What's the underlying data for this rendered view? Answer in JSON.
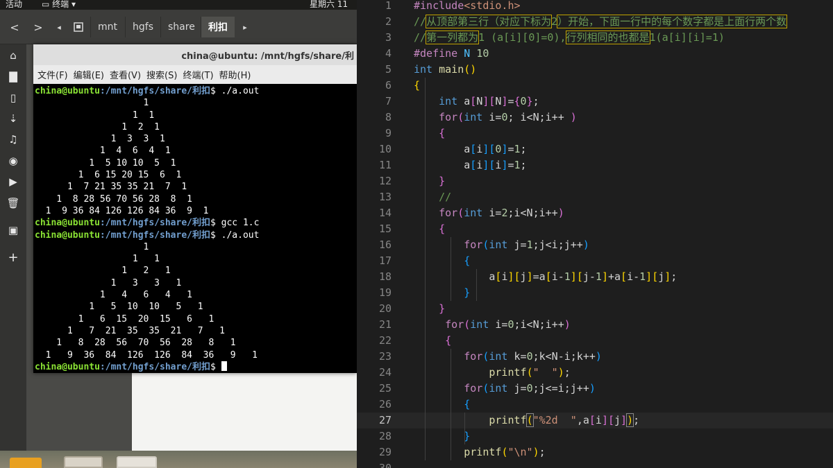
{
  "desktop": {
    "topbar": {
      "activities": "活动",
      "app_menu": "终端",
      "clock": "星期六 11"
    },
    "file_manager": {
      "back": "<",
      "forward": ">",
      "breadcrumbs": [
        "mnt",
        "hgfs",
        "share",
        "利扣"
      ]
    },
    "terminal": {
      "title": "china@ubuntu: /mnt/hgfs/share/利",
      "menu": [
        "文件(F)",
        "编辑(E)",
        "查看(V)",
        "搜索(S)",
        "终端(T)",
        "帮助(H)"
      ],
      "prompt_user": "china@ubuntu",
      "prompt_path": ":/mnt/hgfs/share/利扣",
      "lines": [
        {
          "kind": "prompt",
          "cmd": "$ ./a.out"
        },
        {
          "kind": "out",
          "text": "                    1"
        },
        {
          "kind": "out",
          "text": "                  1  1"
        },
        {
          "kind": "out",
          "text": "                1  2  1"
        },
        {
          "kind": "out",
          "text": "              1  3  3  1"
        },
        {
          "kind": "out",
          "text": "            1  4  6  4  1"
        },
        {
          "kind": "out",
          "text": "          1  5 10 10  5  1"
        },
        {
          "kind": "out",
          "text": "        1  6 15 20 15  6  1"
        },
        {
          "kind": "out",
          "text": "      1  7 21 35 35 21  7  1"
        },
        {
          "kind": "out",
          "text": "    1  8 28 56 70 56 28  8  1"
        },
        {
          "kind": "out",
          "text": "  1  9 36 84 126 126 84 36  9  1"
        },
        {
          "kind": "prompt",
          "cmd": "$ gcc 1.c"
        },
        {
          "kind": "prompt",
          "cmd": "$ ./a.out"
        },
        {
          "kind": "out",
          "text": "                    1"
        },
        {
          "kind": "out",
          "text": "                  1   1"
        },
        {
          "kind": "out",
          "text": "                1   2   1"
        },
        {
          "kind": "out",
          "text": "              1   3   3   1"
        },
        {
          "kind": "out",
          "text": "            1   4   6   4   1"
        },
        {
          "kind": "out",
          "text": "          1   5  10  10   5   1"
        },
        {
          "kind": "out",
          "text": "        1   6  15  20  15   6   1"
        },
        {
          "kind": "out",
          "text": "      1   7  21  35  35  21   7   1"
        },
        {
          "kind": "out",
          "text": "    1   8  28  56  70  56  28   8   1"
        },
        {
          "kind": "out",
          "text": "  1   9  36  84  126  126  84  36   9   1"
        },
        {
          "kind": "prompt",
          "cmd": "$ "
        }
      ]
    }
  },
  "editor": {
    "lines": [
      {
        "n": "1",
        "html": "<span class=\"pr\">#include</span><span class=\"st\">&lt;stdio.h&gt;</span>"
      },
      {
        "n": "2",
        "html": "<span class=\"cm\">//<span class=\"hl\">从顶部第三行（对应下标为</span>2<span class=\"hl\">）开始，下面一行中的每个数字都是上面行两个数</span></span>"
      },
      {
        "n": "3",
        "html": "<span class=\"cm\">//<span class=\"hl\">第一列都为</span>1 (a[i][0]=0),<span class=\"hl\">行列相同的也都是</span>1(a[i][i]=1)</span>"
      },
      {
        "n": "4",
        "html": "<span class=\"pr\">#define</span> <span class=\"ct\">N</span> <span class=\"nm\">10</span>"
      },
      {
        "n": "5",
        "html": "<span class=\"kw\">int</span> <span class=\"fn\">main</span><span class=\"b1\">()</span>"
      },
      {
        "n": "6",
        "html": "<span class=\"b1\">{</span>"
      },
      {
        "n": "7",
        "html": "    <span class=\"kw\">int</span> a<span class=\"b2\">[</span>N<span class=\"b2\">]</span><span class=\"b2\">[</span>N<span class=\"b2\">]</span>=<span class=\"b2\">{</span><span class=\"nm\">0</span><span class=\"b2\">}</span>;"
      },
      {
        "n": "8",
        "html": "    <span class=\"pr\">for</span><span class=\"b2\">(</span><span class=\"kw\">int</span> i=<span class=\"nm\">0</span>; i&lt;N;i++ <span class=\"b2\">)</span>"
      },
      {
        "n": "9",
        "html": "    <span class=\"b2\">{</span>"
      },
      {
        "n": "10",
        "html": "        a<span class=\"b3\">[</span>i<span class=\"b3\">]</span><span class=\"b3\">[</span><span class=\"nm\">0</span><span class=\"b3\">]</span>=<span class=\"nm\">1</span>;"
      },
      {
        "n": "11",
        "html": "        a<span class=\"b3\">[</span>i<span class=\"b3\">]</span><span class=\"b3\">[</span>i<span class=\"b3\">]</span>=<span class=\"nm\">1</span>;"
      },
      {
        "n": "12",
        "html": "    <span class=\"b2\">}</span>"
      },
      {
        "n": "13",
        "html": "    <span class=\"cm\">//</span>"
      },
      {
        "n": "14",
        "html": "    <span class=\"pr\">for</span><span class=\"b2\">(</span><span class=\"kw\">int</span> i=<span class=\"nm\">2</span>;i&lt;N;i++<span class=\"b2\">)</span>"
      },
      {
        "n": "15",
        "html": "    <span class=\"b2\">{</span>"
      },
      {
        "n": "16",
        "html": "        <span class=\"pr\">for</span><span class=\"b3\">(</span><span class=\"kw\">int</span> j=<span class=\"nm\">1</span>;j&lt;i;j++<span class=\"b3\">)</span>"
      },
      {
        "n": "17",
        "html": "        <span class=\"b3\">{</span>"
      },
      {
        "n": "18",
        "html": "            a<span class=\"b1\">[</span>i<span class=\"b1\">]</span><span class=\"b1\">[</span>j<span class=\"b1\">]</span>=a<span class=\"b1\">[</span>i-<span class=\"nm\">1</span><span class=\"b1\">]</span><span class=\"b1\">[</span>j-<span class=\"nm\">1</span><span class=\"b1\">]</span>+a<span class=\"b1\">[</span>i-<span class=\"nm\">1</span><span class=\"b1\">]</span><span class=\"b1\">[</span>j<span class=\"b1\">]</span>;"
      },
      {
        "n": "19",
        "html": "        <span class=\"b3\">}</span>"
      },
      {
        "n": "20",
        "html": "    <span class=\"b2\">}</span>"
      },
      {
        "n": "21",
        "html": "     <span class=\"pr\">for</span><span class=\"b2\">(</span><span class=\"kw\">int</span> i=<span class=\"nm\">0</span>;i&lt;N;i++<span class=\"b2\">)</span>"
      },
      {
        "n": "22",
        "html": "     <span class=\"b2\">{</span>"
      },
      {
        "n": "23",
        "html": "        <span class=\"pr\">for</span><span class=\"b3\">(</span><span class=\"kw\">int</span> k=<span class=\"nm\">0</span>;k&lt;N-i;k++<span class=\"b3\">)</span>"
      },
      {
        "n": "24",
        "html": "            <span class=\"fn\">printf</span><span class=\"b1\">(</span><span class=\"st\">\"  \"</span><span class=\"b1\">)</span>;"
      },
      {
        "n": "25",
        "html": "        <span class=\"pr\">for</span><span class=\"b3\">(</span><span class=\"kw\">int</span> j=<span class=\"nm\">0</span>;j&lt;=i;j++<span class=\"b3\">)</span>"
      },
      {
        "n": "26",
        "html": "        <span class=\"b3\">{</span>"
      },
      {
        "n": "27",
        "html": "            <span class=\"fn\">printf</span><span class=\"b1\" style=\"outline:1px solid #888\">(</span><span class=\"st\">\"%2d  \"</span>,a<span class=\"b2\">[</span>i<span class=\"b2\">]</span><span class=\"b2\">[</span>j<span class=\"b2\">]</span><span class=\"b1\" style=\"outline:1px solid #888\">)</span>;"
      },
      {
        "n": "28",
        "html": "        <span class=\"b3\">}</span>"
      },
      {
        "n": "29",
        "html": "        <span class=\"fn\">printf</span><span class=\"b1\">(</span><span class=\"st\">\"\\n\"</span><span class=\"b1\">)</span>;"
      },
      {
        "n": "30",
        "html": ""
      }
    ]
  }
}
